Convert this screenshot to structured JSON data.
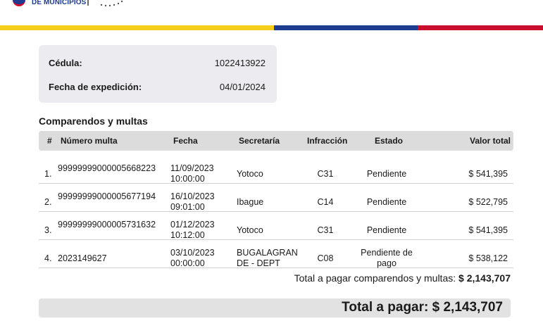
{
  "header": {
    "logo_text": "DE MUNICIPIOS",
    "colors": {
      "yellow": "#f6cf1c",
      "blue": "#1f3d8f",
      "red": "#c8102e"
    }
  },
  "identity": {
    "cedula_label": "Cédula:",
    "cedula_value": "1022413922",
    "expedicion_label": "Fecha de expedición:",
    "expedicion_value": "04/01/2024"
  },
  "fines": {
    "title": "Comparendos y multas",
    "columns": [
      "#",
      "Número multa",
      "Fecha",
      "Secretaría",
      "Infracción",
      "Estado",
      "Valor total"
    ],
    "rows": [
      {
        "index": "1.",
        "numero": "99999999000005668223",
        "fecha": "11/09/2023\n10:00:00",
        "secretaria": "Yotoco",
        "infraccion": "C31",
        "estado": "Pendiente",
        "valor": "$ 541,395"
      },
      {
        "index": "2.",
        "numero": "99999999000005677194",
        "fecha": "16/10/2023\n09:01:00",
        "secretaria": "Ibague",
        "infraccion": "C14",
        "estado": "Pendiente",
        "valor": "$ 522,795"
      },
      {
        "index": "3.",
        "numero": "99999999000005731632",
        "fecha": "01/12/2023\n10:12:00",
        "secretaria": "Yotoco",
        "infraccion": "C31",
        "estado": "Pendiente",
        "valor": "$ 541,395"
      },
      {
        "index": "4.",
        "numero": "2023149627",
        "fecha": "03/10/2023\n00:00:00",
        "secretaria": "BUGALAGRAN\nDE - DEPT",
        "infraccion": "C08",
        "estado": "Pendiente de\npago",
        "valor": "$ 538,122"
      }
    ],
    "subtotal_label": "Total a pagar comparendos y multas:",
    "subtotal_value": "$ 2,143,707"
  },
  "total": {
    "label": "Total a pagar:",
    "value": "$ 2,143,707"
  }
}
